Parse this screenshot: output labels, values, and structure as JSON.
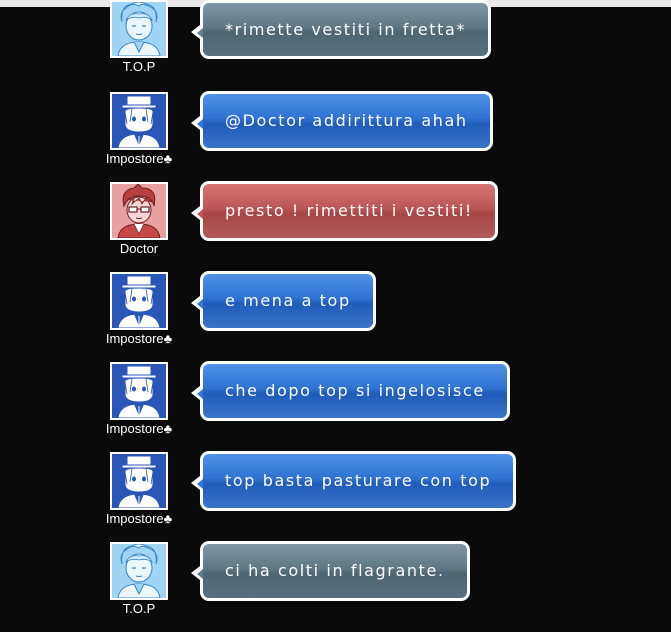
{
  "colors": {
    "background": "#0a0a0a",
    "bubble_border": "#ffffff",
    "bubble_blue": "#2f72d2",
    "bubble_gray": "#5e7886",
    "bubble_red": "#bc5656"
  },
  "messages": [
    {
      "user": "T.O.P",
      "avatar": "top-avatar-icon",
      "theme": "gray",
      "text": "*rimette vestiti in fretta*"
    },
    {
      "user": "Impostore♣",
      "avatar": "impostore-avatar-icon",
      "theme": "blue",
      "text": "@Doctor addirittura ahah"
    },
    {
      "user": "Doctor",
      "avatar": "doctor-avatar-icon",
      "theme": "red",
      "text": "presto ! rimettiti i vestiti!"
    },
    {
      "user": "Impostore♣",
      "avatar": "impostore-avatar-icon",
      "theme": "blue",
      "text": "e mena a top"
    },
    {
      "user": "Impostore♣",
      "avatar": "impostore-avatar-icon",
      "theme": "blue",
      "text": "che dopo top si ingelosisce"
    },
    {
      "user": "Impostore♣",
      "avatar": "impostore-avatar-icon",
      "theme": "blue",
      "text": "top basta pasturare con top"
    },
    {
      "user": "T.O.P",
      "avatar": "top-avatar-icon",
      "theme": "gray",
      "text": "ci ha colti in flagrante."
    }
  ]
}
